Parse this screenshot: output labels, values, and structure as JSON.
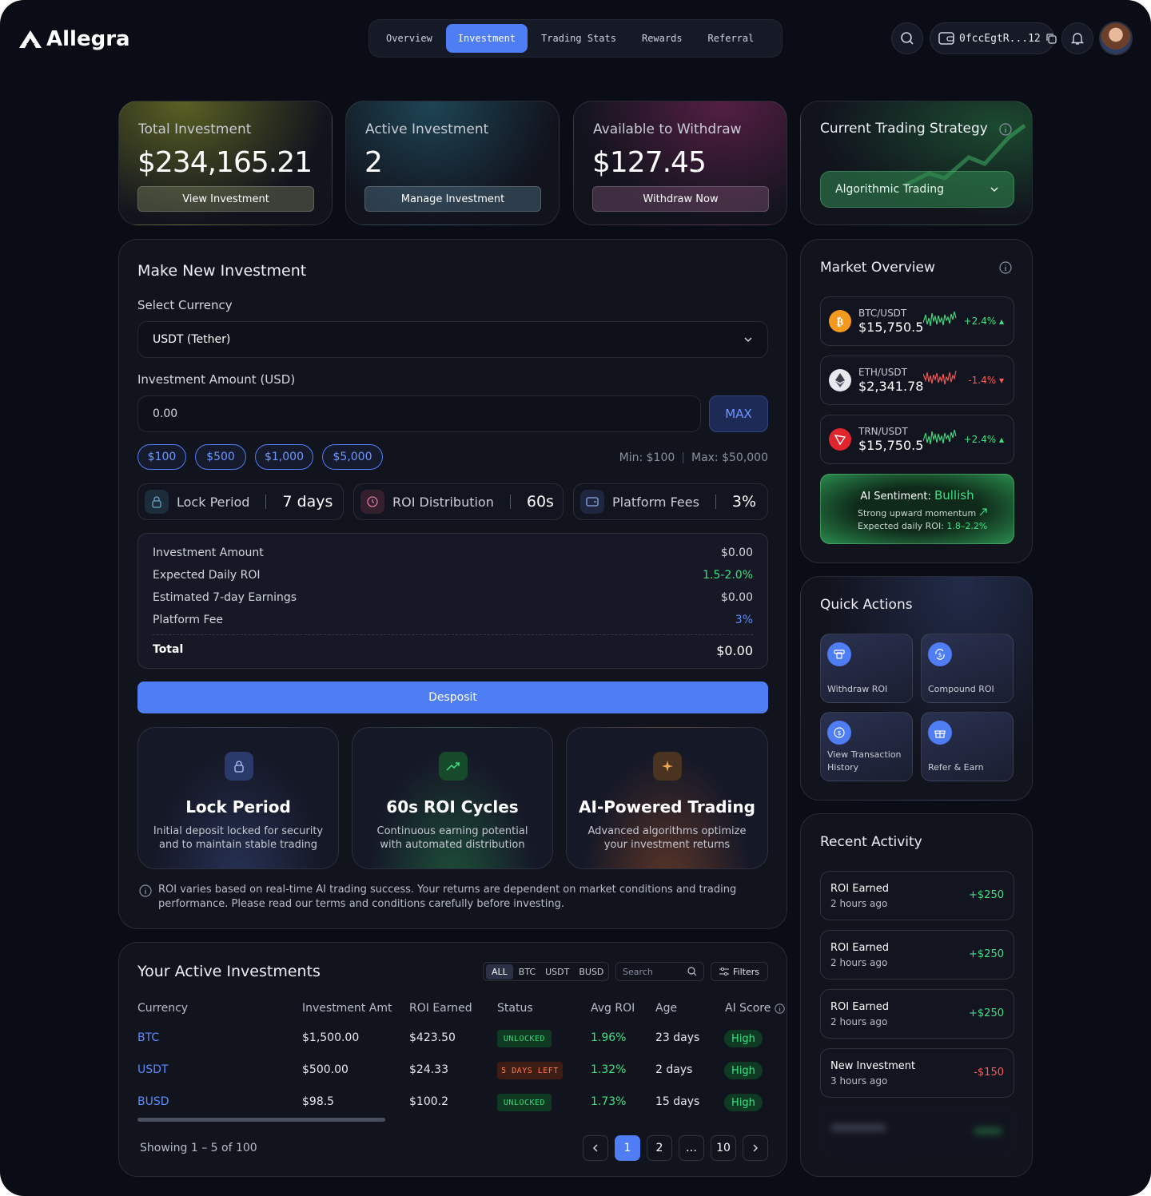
{
  "brand": {
    "name": "Allegra"
  },
  "nav": {
    "tabs": [
      "Overview",
      "Investment",
      "Trading Stats",
      "Rewards",
      "Referral"
    ],
    "active": "Investment"
  },
  "header": {
    "wallet_address": "0fccEgtR...12"
  },
  "stats": {
    "total": {
      "label": "Total Investment",
      "value": "$234,165.21",
      "button": "View Investment"
    },
    "active": {
      "label": "Active Investment",
      "value": "2",
      "button": "Manage Investment"
    },
    "withdraw": {
      "label": "Available to Withdraw",
      "value": "$127.45",
      "button": "Withdraw Now"
    }
  },
  "strategy": {
    "title": "Current Trading Strategy",
    "selected": "Algorithmic Trading"
  },
  "invest": {
    "title": "Make New Investment",
    "currency_label": "Select Currency",
    "currency_value": "USDT (Tether)",
    "amount_label": "Investment Amount (USD)",
    "amount_value": "0.00",
    "max_label": "MAX",
    "presets": [
      "$100",
      "$500",
      "$1,000",
      "$5,000"
    ],
    "min": "Min: $100",
    "max": "Max: $50,000",
    "info": [
      {
        "label": "Lock Period",
        "value": "7 days"
      },
      {
        "label": "ROI Distribution",
        "value": "60s"
      },
      {
        "label": "Platform Fees",
        "value": "3%"
      }
    ],
    "summary": [
      {
        "label": "Investment Amount",
        "value": "$0.00"
      },
      {
        "label": "Expected Daily ROI",
        "value": "1.5-2.0%"
      },
      {
        "label": "Estimated 7-day Earnings",
        "value": "$0.00"
      },
      {
        "label": "Platform Fee",
        "value": "3%"
      }
    ],
    "total_label": "Total",
    "total_value": "$0.00",
    "deposit_label": "Desposit",
    "features": [
      {
        "title": "Lock Period",
        "desc": "Initial deposit locked for security and to maintain stable trading"
      },
      {
        "title": "60s ROI Cycles",
        "desc": "Continuous earning potential with automated distribution"
      },
      {
        "title": "AI-Powered Trading",
        "desc": "Advanced algorithms optimize your investment returns"
      }
    ],
    "disclaimer": "ROI varies based on real-time AI trading success. Your returns are dependent on market conditions and trading performance. Please read our terms and conditions carefully before investing."
  },
  "table": {
    "title": "Your Active Investments",
    "filters": [
      "ALL",
      "BTC",
      "USDT",
      "BUSD"
    ],
    "search_placeholder": "Search",
    "filters_label": "Filters",
    "columns": [
      "Currency",
      "Investment Amt",
      "ROI Earned",
      "Status",
      "Avg ROI",
      "Age",
      "AI Score"
    ],
    "rows": [
      {
        "currency": "BTC",
        "amount": "$1,500.00",
        "roi": "$423.50",
        "status": "UNLOCKED",
        "avg": "1.96%",
        "age": "23 days",
        "score": "High"
      },
      {
        "currency": "USDT",
        "amount": "$500.00",
        "roi": "$24.33",
        "status": "5 DAYS LEFT",
        "avg": "1.32%",
        "age": "2 days",
        "score": "High"
      },
      {
        "currency": "BUSD",
        "amount": "$98.5",
        "roi": "$100.2",
        "status": "UNLOCKED",
        "avg": "1.73%",
        "age": "15 days",
        "score": "High"
      }
    ],
    "showing": "Showing 1 – 5 of 100",
    "pages": [
      "1",
      "2",
      "…",
      "10"
    ]
  },
  "market": {
    "title": "Market Overview",
    "items": [
      {
        "pair": "BTC/USDT",
        "price": "$15,750.5",
        "change": "+2.4%",
        "dir": "up"
      },
      {
        "pair": "ETH/USDT",
        "price": "$2,341.78",
        "change": "-1.4%",
        "dir": "down"
      },
      {
        "pair": "TRN/USDT",
        "price": "$15,750.5",
        "change": "+2.4%",
        "dir": "up"
      }
    ],
    "sentiment": {
      "label": "AI Sentiment:",
      "value": "Bullish",
      "line1": "Strong upward momentum",
      "line2_label": "Expected daily ROI:",
      "line2_value": "1.8–2.2%"
    }
  },
  "quick": {
    "title": "Quick Actions",
    "items": [
      "Withdraw ROI",
      "Compound ROI",
      "View Transaction History",
      "Refer & Earn"
    ]
  },
  "activity": {
    "title": "Recent Activity",
    "items": [
      {
        "title": "ROI Earned",
        "time": "2 hours ago",
        "amount": "+$250",
        "dir": "up"
      },
      {
        "title": "ROI Earned",
        "time": "2 hours ago",
        "amount": "+$250",
        "dir": "up"
      },
      {
        "title": "ROI Earned",
        "time": "2 hours ago",
        "amount": "+$250",
        "dir": "up"
      },
      {
        "title": "New Investment",
        "time": "3 hours ago",
        "amount": "-$150",
        "dir": "down"
      }
    ]
  },
  "colors": {
    "accent": "#4f7df3",
    "positive": "#3ee282",
    "negative": "#ff5a5a"
  }
}
